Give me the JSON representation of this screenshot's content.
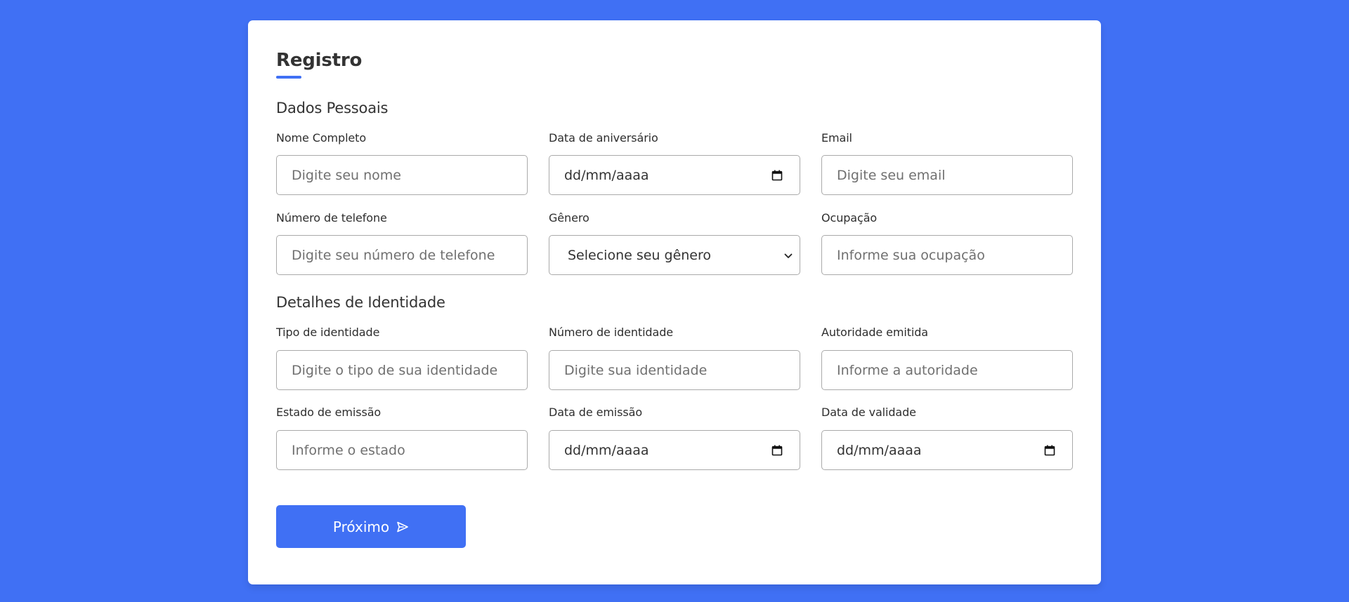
{
  "form": {
    "title": "Registro",
    "next_button_label": "Próximo",
    "next_button_icon": "send-icon"
  },
  "personal": {
    "section_title": "Dados Pessoais",
    "full_name": {
      "label": "Nome Completo",
      "placeholder": "Digite seu nome"
    },
    "birth_date": {
      "label": "Data de aniversário",
      "value": "dd/mm/aaaa",
      "icon": "calendar-icon"
    },
    "email": {
      "label": "Email",
      "placeholder": "Digite seu email"
    },
    "phone": {
      "label": "Número de telefone",
      "placeholder": "Digite seu número de telefone"
    },
    "gender": {
      "label": "Gênero",
      "selected": "Selecione seu gênero",
      "icon": "chevron-down-icon"
    },
    "occupation": {
      "label": "Ocupação",
      "placeholder": "Informe sua ocupação"
    }
  },
  "identity": {
    "section_title": "Detalhes de Identidade",
    "id_type": {
      "label": "Tipo de identidade",
      "placeholder": "Digite o tipo de sua identidade"
    },
    "id_number": {
      "label": "Número de identidade",
      "placeholder": "Digite sua identidade"
    },
    "authority": {
      "label": "Autoridade emitida",
      "placeholder": "Informe a autoridade"
    },
    "issue_state": {
      "label": "Estado de emissão",
      "placeholder": "Informe o estado"
    },
    "issue_date": {
      "label": "Data de emissão",
      "value": "dd/mm/aaaa",
      "icon": "calendar-icon"
    },
    "expiry_date": {
      "label": "Data de validade",
      "value": "dd/mm/aaaa",
      "icon": "calendar-icon"
    }
  },
  "colors": {
    "background": "#4070f4",
    "accent": "#4070f4",
    "card": "#ffffff"
  }
}
